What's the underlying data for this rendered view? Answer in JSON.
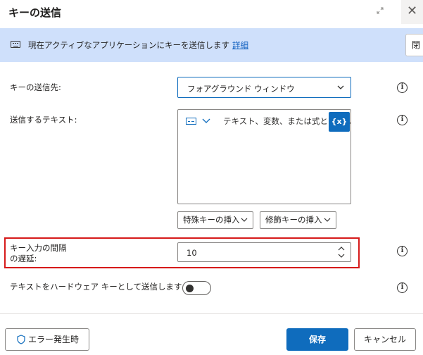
{
  "dialog": {
    "title": "キーの送信",
    "expand_icon": "↗↙",
    "close_icon": "✕"
  },
  "infobar": {
    "icon": "keyboard-icon",
    "text": "現在アクティブなアプリケーションにキーを送信します",
    "link": "詳細",
    "right_button": "閉"
  },
  "fields": {
    "target": {
      "label": "キーの送信先:",
      "value": "フォアグラウンド ウィンドウ"
    },
    "text": {
      "label": "送信するテキスト:",
      "placeholder": "テキスト、変数、または式として入",
      "var_button": "{x}"
    },
    "special_key_button": "特殊キーの挿入",
    "modifier_key_button": "修飾キーの挿入",
    "delay": {
      "label_line1": "キー入力の間隔",
      "label_line2": "の遅延:",
      "value": "10"
    },
    "hardware": {
      "label": "テキストをハードウェア キーとして送信します:",
      "toggle_on": false
    },
    "info_icon": "i"
  },
  "footer": {
    "error_button": "エラー発生時",
    "save_button": "保存",
    "cancel_button": "キャンセル"
  },
  "colors": {
    "accent": "#0f6cbd",
    "infobar_bg": "#cfe0fb",
    "highlight": "#d61a1a"
  }
}
